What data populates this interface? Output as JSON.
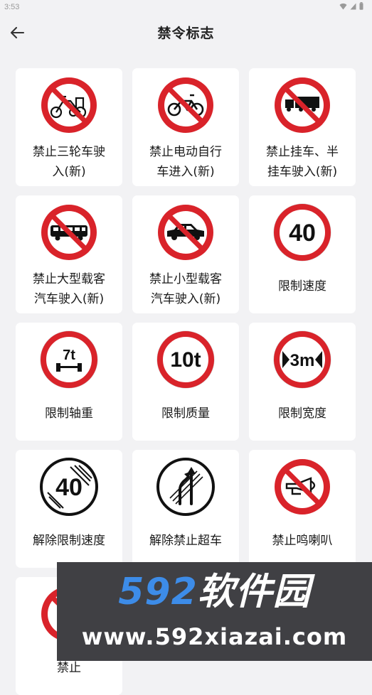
{
  "status": {
    "time": "3:53"
  },
  "header": {
    "title": "禁令标志"
  },
  "signs": [
    {
      "label": "禁止三轮车驶入(新)",
      "line1": "禁止三轮车驶",
      "line2": "入(新)",
      "icon": "no-tricycle-icon"
    },
    {
      "label": "禁止电动自行车进入(新)",
      "line1": "禁止电动自行",
      "line2": "车进入(新)",
      "icon": "no-electric-bicycle-icon"
    },
    {
      "label": "禁止挂车、半挂车驶入(新)",
      "line1": "禁止挂车、半",
      "line2": "挂车驶入(新)",
      "icon": "no-trailer-icon"
    },
    {
      "label": "禁止大型载客汽车驶入(新)",
      "line1": "禁止大型载客",
      "line2": "汽车驶入(新)",
      "icon": "no-bus-icon"
    },
    {
      "label": "禁止小型载客汽车驶入(新)",
      "line1": "禁止小型载客",
      "line2": "汽车驶入(新)",
      "icon": "no-car-icon"
    },
    {
      "label": "限制速度",
      "line1": "限制速度",
      "line2": "",
      "icon": "speed-limit-icon",
      "text": "40"
    },
    {
      "label": "限制轴重",
      "line1": "限制轴重",
      "line2": "",
      "icon": "axle-weight-limit-icon",
      "text": "7t"
    },
    {
      "label": "限制质量",
      "line1": "限制质量",
      "line2": "",
      "icon": "weight-limit-icon",
      "text": "10t"
    },
    {
      "label": "限制宽度",
      "line1": "限制宽度",
      "line2": "",
      "icon": "width-limit-icon",
      "text": "3m"
    },
    {
      "label": "解除限制速度",
      "line1": "解除限制速度",
      "line2": "",
      "icon": "end-speed-limit-icon",
      "text": "40"
    },
    {
      "label": "解除禁止超车",
      "line1": "解除禁止超车",
      "line2": "",
      "icon": "end-no-overtaking-icon"
    },
    {
      "label": "禁止鸣喇叭",
      "line1": "禁止鸣喇叭",
      "line2": "",
      "icon": "no-horn-icon"
    },
    {
      "label": "禁止…",
      "line1": "禁止",
      "line2": "",
      "icon": "partial-sign-icon"
    }
  ],
  "watermark": {
    "brand_num": "592",
    "brand_cn": "软件园",
    "url": "www.592xiazai.com"
  },
  "colors": {
    "red": "#d9232a",
    "background": "#f2f2f4",
    "card": "#ffffff",
    "watermark_bg": "#404044",
    "watermark_blue": "#3d8ce8"
  }
}
